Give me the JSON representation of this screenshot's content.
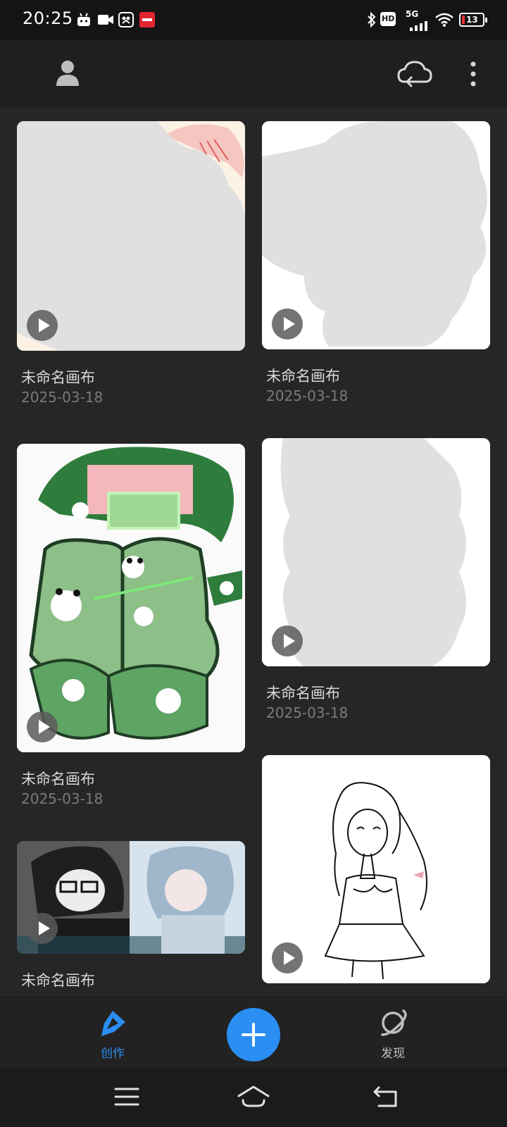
{
  "status_bar": {
    "time": "20:25",
    "left_icons": [
      "android-icon",
      "video-icon",
      "gallery-icon",
      "red-app-icon"
    ],
    "hd_label": "HD",
    "network_label": "5G",
    "battery_level": "13"
  },
  "top_bar": {
    "profile_icon": "person-icon",
    "cloud_icon": "cloud-sync-icon",
    "menu_icon": "more-vertical-icon"
  },
  "canvases": [
    {
      "title": "未命名画布",
      "date": "2025-03-18"
    },
    {
      "title": "未命名画布",
      "date": "2025-03-18"
    },
    {
      "title": "未命名画布",
      "date": "2025-03-18"
    },
    {
      "title": "未命名画布",
      "date": "2025-03-18"
    },
    {
      "title": "未命名画布",
      "date": ""
    },
    {
      "title": "",
      "date": ""
    }
  ],
  "bottom_nav": {
    "create_label": "创作",
    "discover_label": "发现",
    "active_color": "#2a8ef3",
    "inactive_color": "#bdbdbd"
  },
  "system_nav": {
    "menu_icon": "menu-icon",
    "home_icon": "home-icon",
    "back_icon": "back-icon"
  }
}
